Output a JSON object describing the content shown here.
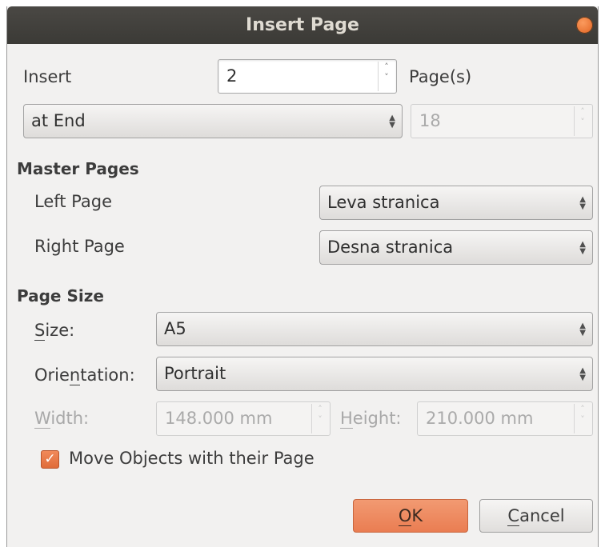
{
  "dialog": {
    "title": "Insert Page"
  },
  "insert": {
    "label": "Insert",
    "count_value": "2",
    "unit_label": "Page(s)",
    "position_value": "at End",
    "page_number_value": "18"
  },
  "master_pages": {
    "heading": "Master Pages",
    "left_label": "Left Page",
    "left_value": "Leva stranica",
    "right_label": "Right Page",
    "right_value": "Desna stranica"
  },
  "page_size": {
    "heading": "Page Size",
    "size_label_u": "S",
    "size_label_rest": "ize:",
    "size_value": "A5",
    "orientation_label_a": "Orie",
    "orientation_label_u": "n",
    "orientation_label_b": "tation:",
    "orientation_value": "Portrait",
    "width_label_u": "W",
    "width_label_rest": "idth:",
    "width_value": "148.000 mm",
    "height_label_u": "H",
    "height_label_rest": "eight:",
    "height_value": "210.000 mm"
  },
  "move_objects": {
    "label": "Move Objects with their Page",
    "checked": true
  },
  "buttons": {
    "ok_u": "O",
    "ok_rest": "K",
    "cancel_u": "C",
    "cancel_rest": "ancel"
  },
  "colors": {
    "accent": "#ea7d52",
    "titlebar": "#3b3a36"
  },
  "icons": {
    "close": "close-icon",
    "spin_up": "up-arrow-icon",
    "spin_down": "down-arrow-icon",
    "combo": "updown-arrow-icon",
    "check": "checkmark-icon"
  }
}
